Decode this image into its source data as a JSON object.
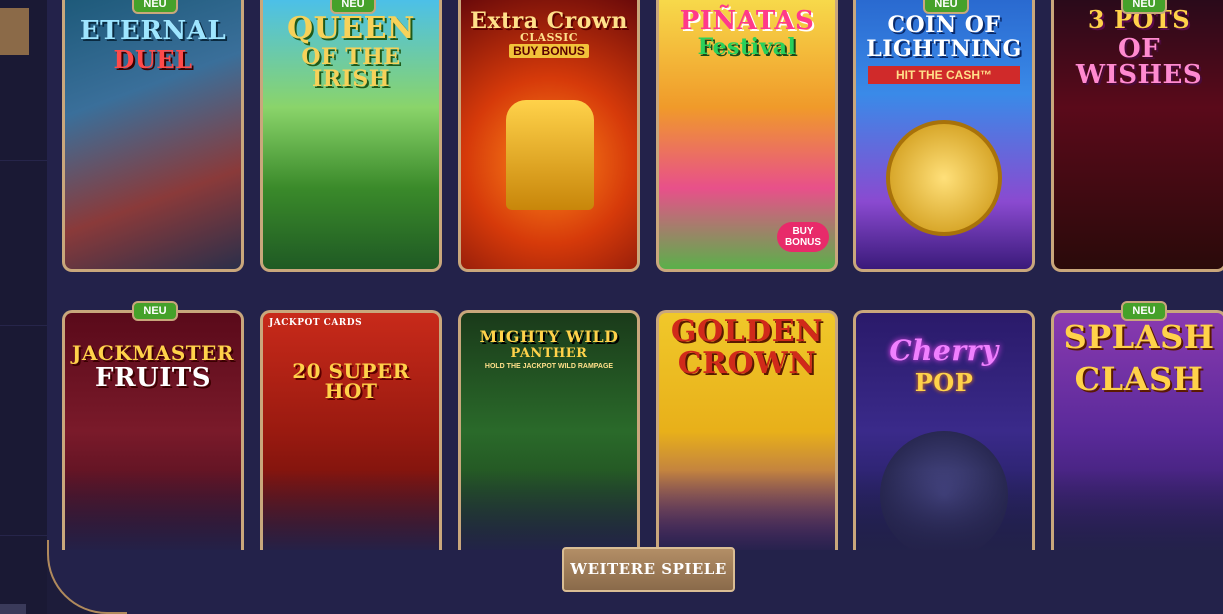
{
  "badge_label": "NEU",
  "more_button": "WEITERE SPIELE",
  "games_row1": [
    {
      "title": "ETERNAL",
      "title2": "DUEL",
      "badge": true
    },
    {
      "title": "QUEEN",
      "title2": "OF THE IRISH",
      "badge": true
    },
    {
      "title": "Extra Crown",
      "title2": "CLASSIC",
      "tag": "BUY BONUS",
      "badge": false
    },
    {
      "title": "PIÑATAS",
      "title2": "Festival",
      "tag": "BUY BONUS",
      "badge": false
    },
    {
      "title": "COIN OF",
      "title2": "LIGHTNING",
      "tag": "HIT THE CASH™",
      "badge": true
    },
    {
      "title": "3 POTS",
      "title2": "OF WISHES",
      "badge": true
    }
  ],
  "games_row2": [
    {
      "title": "JACKMASTER",
      "title2": "FRUITS",
      "badge": true
    },
    {
      "title": "20 SUPER HOT",
      "title2": "JACKPOT CARDS",
      "badge": false
    },
    {
      "title": "MIGHTY WILD",
      "title2": "PANTHER",
      "tag": "HOLD THE JACKPOT WILD RAMPAGE",
      "badge": false
    },
    {
      "title": "GOLDEN",
      "title2": "CROWN",
      "badge": false
    },
    {
      "title": "Cherry",
      "title2": "POP",
      "badge": false
    },
    {
      "title": "SPLASH",
      "title2": "CLASH",
      "badge": true
    }
  ],
  "colors": {
    "accent_gold": "#c9a77c",
    "badge_green": "#45a12a",
    "background": "#23224a"
  }
}
